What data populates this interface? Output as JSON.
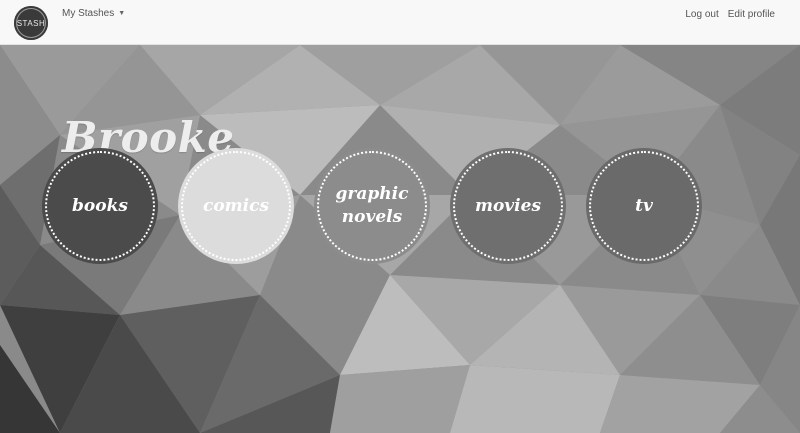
{
  "nav": {
    "logo_text": "STASH",
    "dropdown_label": "My Stashes",
    "logout_label": "Log out",
    "edit_profile_label": "Edit profile"
  },
  "profile": {
    "name": "Brooke"
  },
  "stashes": [
    {
      "label": "books",
      "color": "#4b4b4b"
    },
    {
      "label": "comics",
      "color": "#dcdcdc"
    },
    {
      "label": "graphic novels",
      "color": "#8c8c8c"
    },
    {
      "label": "movies",
      "color": "#6f6f6f"
    },
    {
      "label": "tv",
      "color": "#6a6a6a"
    }
  ]
}
